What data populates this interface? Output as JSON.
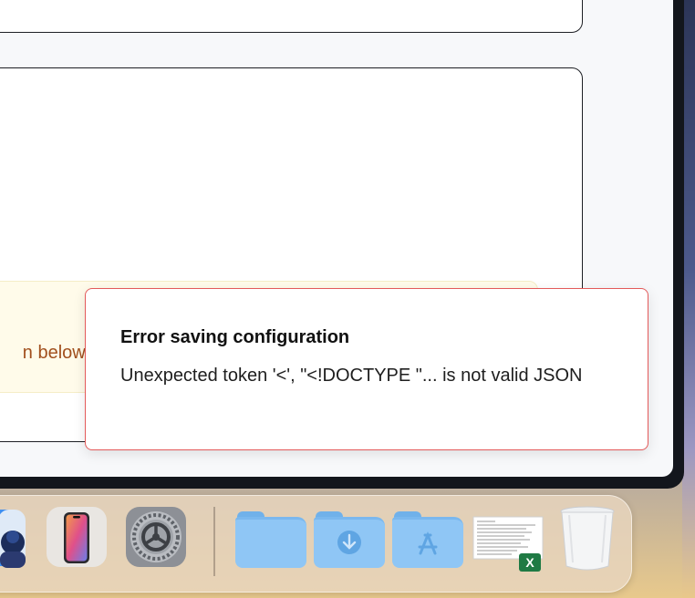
{
  "panel": {
    "warning_text": "n below to start the authentication process."
  },
  "toast": {
    "title": "Error saving configuration",
    "message": "Unexpected token '<', \"<!DOCTYPE \"... is not valid JSON"
  },
  "dock": {
    "items": [
      {
        "icon": "finder-icon"
      },
      {
        "icon": "iphone-mirroring-icon"
      },
      {
        "icon": "system-settings-icon"
      },
      {
        "icon": "folder-icon"
      },
      {
        "icon": "downloads-folder-icon"
      },
      {
        "icon": "applications-folder-icon"
      },
      {
        "icon": "excel-document-icon"
      },
      {
        "icon": "trash-icon"
      }
    ]
  },
  "colors": {
    "warning_text": "#a14f1d",
    "warning_bg": "#fffbea",
    "toast_border": "#e35a5a",
    "folder": "#8fc6f5"
  }
}
